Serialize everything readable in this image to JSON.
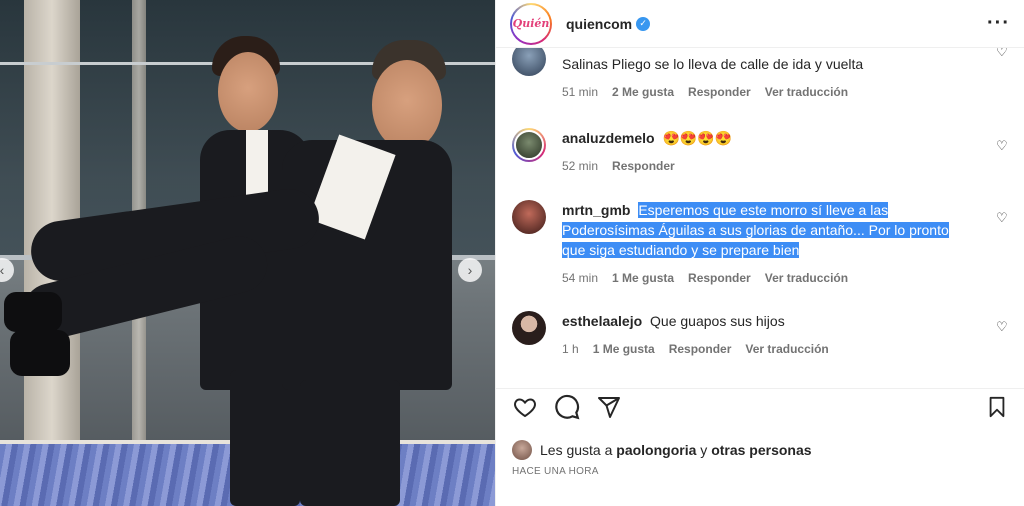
{
  "post": {
    "username": "quiencom",
    "logo_text": "Quién"
  },
  "comments": [
    {
      "user": "",
      "text": "Salinas Pliego se lo lleva de calle de ida y vuelta",
      "time": "51 min",
      "likes": "2 Me gusta",
      "reply": "Responder",
      "translate": "Ver traducción"
    },
    {
      "user": "analuzdemelo",
      "text": "😍😍😍😍",
      "time": "52 min",
      "reply": "Responder"
    },
    {
      "user": "mrtn_gmb",
      "text_line1": "Esperemos que este morro sí lleve a las",
      "text_line2": "Poderosísimas Águilas a sus glorias de antaño... Por lo pronto",
      "text_line3": "que siga estudiando y se prepare bien",
      "time": "54 min",
      "likes": "1 Me gusta",
      "reply": "Responder",
      "translate": "Ver traducción"
    },
    {
      "user": "esthelaalejo",
      "text": "Que guapos sus hijos",
      "time": "1 h",
      "likes": "1 Me gusta",
      "reply": "Responder",
      "translate": "Ver traducción"
    }
  ],
  "likes_line": {
    "prefix": "Les gusta a",
    "user": "paolongoria",
    "joiner": "y",
    "others": "otras personas"
  },
  "timestamp": "HACE UNA HORA",
  "icons": {
    "like": "heart-icon",
    "comment": "comment-icon",
    "share": "share-icon",
    "save": "bookmark-icon",
    "verified": "verified-badge-icon",
    "more": "more-options-icon"
  },
  "colors": {
    "highlight": "#3d8df5",
    "verified": "#3897f0",
    "muted": "#737373"
  }
}
